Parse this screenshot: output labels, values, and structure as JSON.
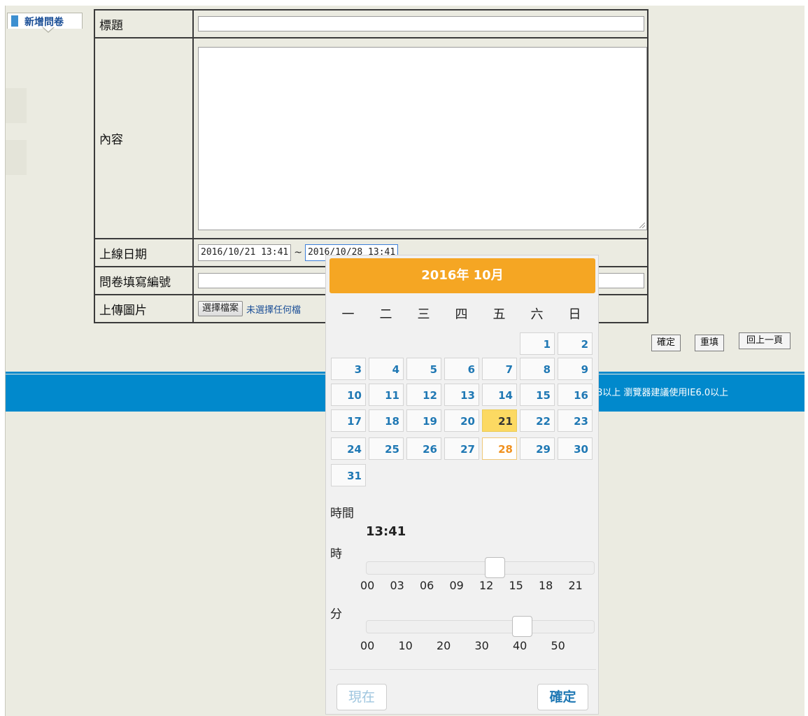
{
  "tab": {
    "label": "新增問卷"
  },
  "form": {
    "title_label": "標題",
    "title_value": "",
    "content_label": "內容",
    "content_value": "",
    "date_label": "上線日期",
    "date_start": "2016/10/21 13:41",
    "date_sep": "~",
    "date_end": "2016/10/28 13:41",
    "serial_label": "問卷填寫編號",
    "serial_value": "",
    "upload_label": "上傳圖片",
    "upload_button": "選擇檔案",
    "upload_status": "未選擇任何檔"
  },
  "actions": {
    "confirm": "確定",
    "reset": "重填",
    "back": "回上一頁"
  },
  "footer": {
    "text": "8以上 瀏覽器建議使用IE6.0以上"
  },
  "datepicker": {
    "header": "2016年 10月",
    "weekdays": [
      "一",
      "二",
      "三",
      "四",
      "五",
      "六",
      "日"
    ],
    "days": [
      "1",
      "2",
      "3",
      "4",
      "5",
      "6",
      "7",
      "8",
      "9",
      "10",
      "11",
      "12",
      "13",
      "14",
      "15",
      "16",
      "17",
      "18",
      "19",
      "20",
      "21",
      "22",
      "23",
      "24",
      "25",
      "26",
      "27",
      "28",
      "29",
      "30",
      "31"
    ],
    "today": "21",
    "selected": "28",
    "time_label": "時間",
    "time_value": "13:41",
    "hour_label": "時",
    "hour_ticks": [
      "00",
      "03",
      "06",
      "09",
      "12",
      "15",
      "18",
      "21"
    ],
    "hour_value": 13,
    "minute_label": "分",
    "minute_ticks": [
      "00",
      "10",
      "20",
      "30",
      "40",
      "50"
    ],
    "minute_value": 41,
    "now_button": "現在",
    "ok_button": "確定"
  }
}
